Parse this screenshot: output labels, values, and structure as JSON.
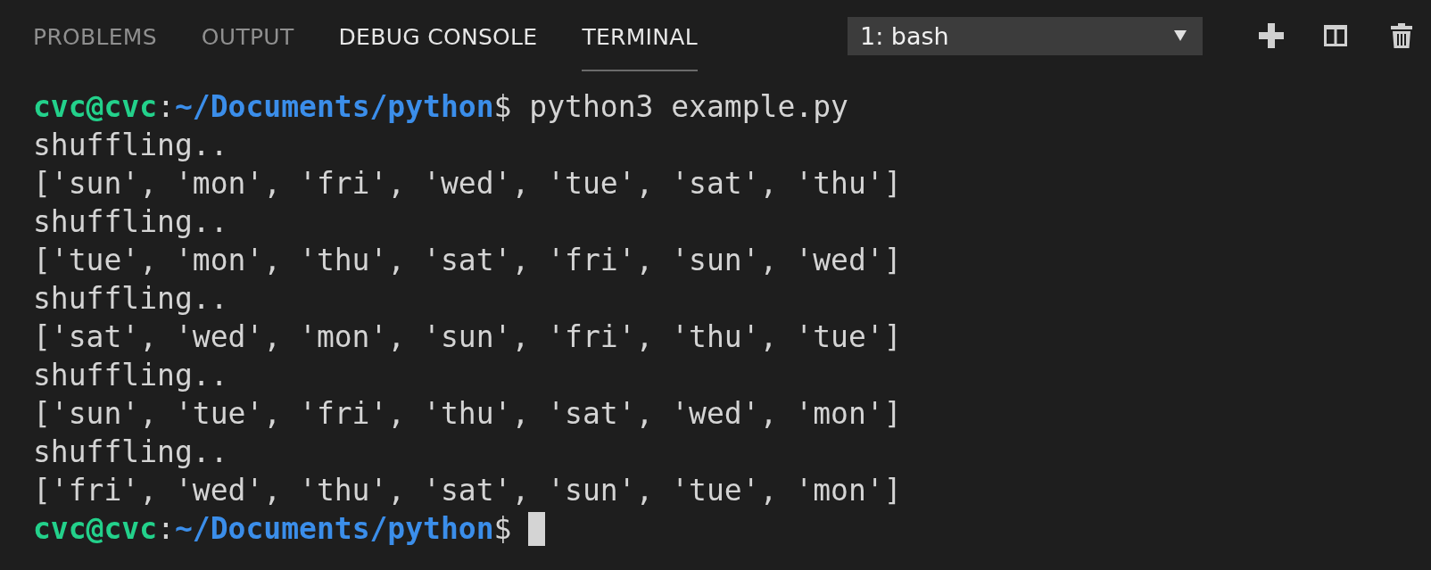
{
  "tabs": [
    {
      "label": "PROBLEMS",
      "selected": false,
      "hovered": false
    },
    {
      "label": "OUTPUT",
      "selected": false,
      "hovered": false
    },
    {
      "label": "DEBUG CONSOLE",
      "selected": false,
      "hovered": true
    },
    {
      "label": "TERMINAL",
      "selected": true,
      "hovered": false
    }
  ],
  "terminal_select": {
    "value": "1: bash"
  },
  "lines": [
    {
      "kind": "prompt",
      "user": "cvc@cvc",
      "separator": ":",
      "path": "~/Documents/python",
      "symbol": "$",
      "command": "python3 example.py",
      "cursor": false
    },
    {
      "kind": "output",
      "text": "shuffling.."
    },
    {
      "kind": "output",
      "text": "['sun', 'mon', 'fri', 'wed', 'tue', 'sat', 'thu']"
    },
    {
      "kind": "output",
      "text": "shuffling.."
    },
    {
      "kind": "output",
      "text": "['tue', 'mon', 'thu', 'sat', 'fri', 'sun', 'wed']"
    },
    {
      "kind": "output",
      "text": "shuffling.."
    },
    {
      "kind": "output",
      "text": "['sat', 'wed', 'mon', 'sun', 'fri', 'thu', 'tue']"
    },
    {
      "kind": "output",
      "text": "shuffling.."
    },
    {
      "kind": "output",
      "text": "['sun', 'tue', 'fri', 'thu', 'sat', 'wed', 'mon']"
    },
    {
      "kind": "output",
      "text": "shuffling.."
    },
    {
      "kind": "output",
      "text": "['fri', 'wed', 'thu', 'sat', 'sun', 'tue', 'mon']"
    },
    {
      "kind": "prompt",
      "user": "cvc@cvc",
      "separator": ":",
      "path": "~/Documents/python",
      "symbol": "$",
      "cursor": true
    }
  ]
}
